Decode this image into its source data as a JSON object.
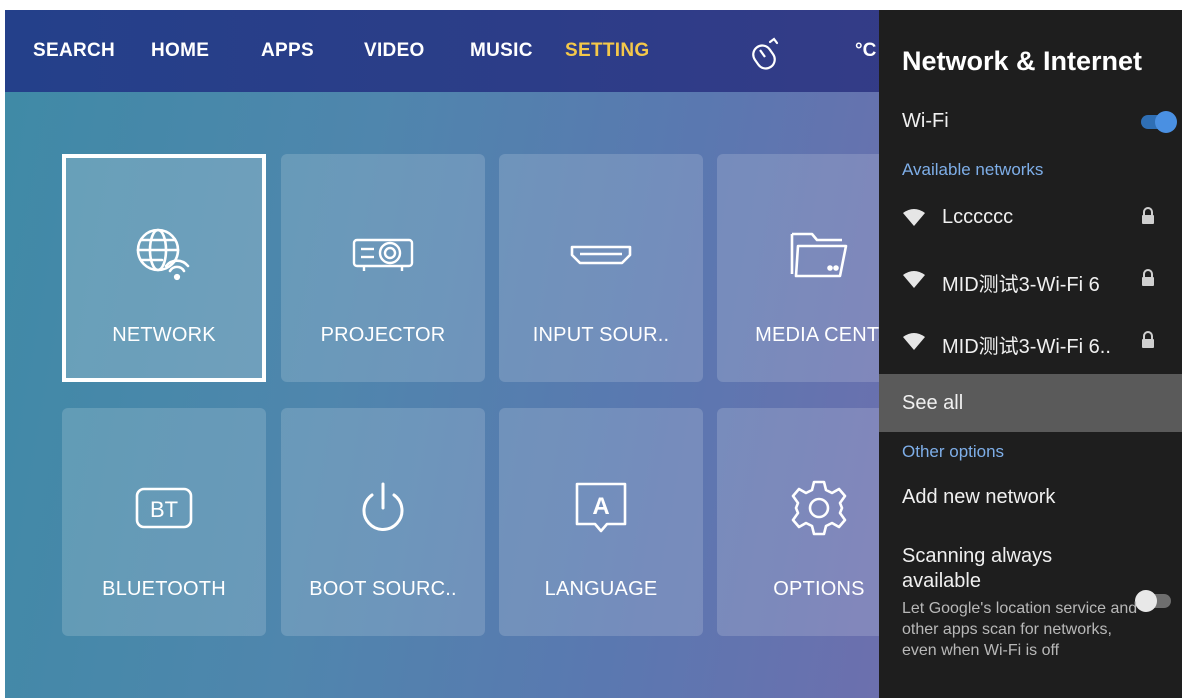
{
  "nav": {
    "items": [
      "SEARCH",
      "HOME",
      "APPS",
      "VIDEO",
      "MUSIC",
      "SETTING"
    ],
    "active": "SETTING",
    "temperature_fragment": "°C"
  },
  "tiles": [
    {
      "label": "NETWORK",
      "icon": "globe-wifi-icon",
      "selected": true
    },
    {
      "label": "PROJECTOR",
      "icon": "projector-icon"
    },
    {
      "label": "INPUT SOUR..",
      "icon": "hdmi-icon"
    },
    {
      "label": "MEDIA CENT.",
      "icon": "folder-icon"
    },
    {
      "label": "BLUETOOTH",
      "icon": "bluetooth-bt-icon"
    },
    {
      "label": "BOOT SOURC..",
      "icon": "power-icon"
    },
    {
      "label": "LANGUAGE",
      "icon": "language-a-icon"
    },
    {
      "label": "OPTIONS",
      "icon": "gear-icon"
    }
  ],
  "panel": {
    "title": "Network & Internet",
    "wifi_label": "Wi-Fi",
    "wifi_on": true,
    "available_header": "Available networks",
    "networks": [
      "Lcccccc",
      "MID测试3-Wi-Fi 6",
      "MID测试3-Wi-Fi 6.."
    ],
    "see_all": "See all",
    "other_header": "Other options",
    "add_network": "Add new network",
    "scanning_title": "Scanning always available",
    "scanning_desc": "Let Google's location service and other apps scan for networks, even when Wi-Fi is off",
    "scanning_on": false
  },
  "colors": {
    "accent_blue": "#4a90e2",
    "nav_active": "#f4c84a",
    "section_header": "#7eaee8",
    "panel_bg": "#1e1e1e"
  }
}
